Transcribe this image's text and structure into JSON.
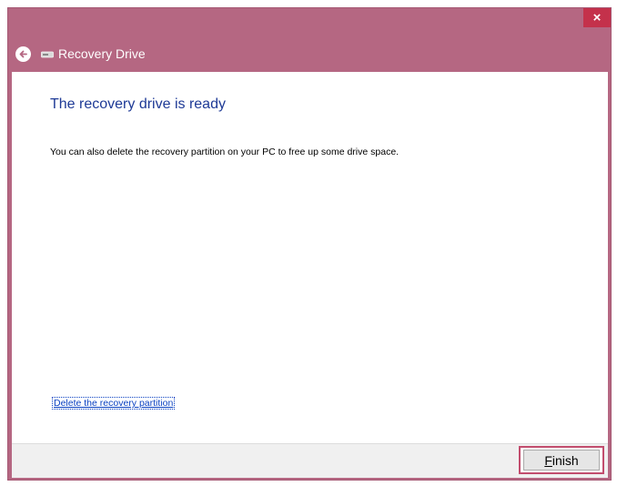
{
  "window": {
    "title": "Recovery Drive",
    "close_glyph": "×"
  },
  "page": {
    "heading": "The recovery drive is ready",
    "description": "You can also delete the recovery partition on your PC to free up some drive space.",
    "delete_link": "Delete the recovery partition"
  },
  "footer": {
    "finish_label": "Finish"
  },
  "icons": {
    "back": "back-arrow-icon",
    "drive": "drive-icon",
    "close": "close-icon"
  },
  "colors": {
    "chrome": "#b56782",
    "close": "#c4314b",
    "heading": "#1e3a96",
    "link": "#0b42c2",
    "highlight": "#c24d6e"
  }
}
